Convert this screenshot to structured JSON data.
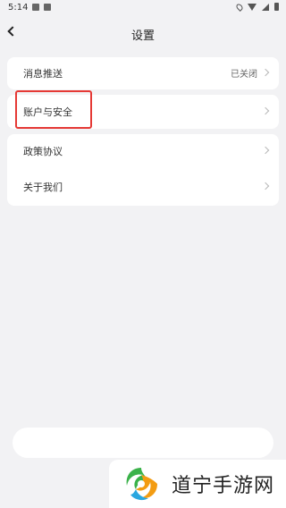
{
  "status_bar": {
    "time": "5:14"
  },
  "nav": {
    "title": "设置"
  },
  "settings": {
    "push": {
      "label": "消息推送",
      "value": "已关闭"
    },
    "account": {
      "label": "账户与安全"
    },
    "policy": {
      "label": "政策协议"
    },
    "about": {
      "label": "关于我们"
    }
  },
  "watermark": {
    "text": "道宁手游网"
  },
  "colors": {
    "background": "#f2f2f4",
    "card": "#ffffff",
    "highlight": "#e53935",
    "logo_green": "#3bb24a",
    "logo_orange": "#f39c12",
    "logo_blue": "#2aa7e0"
  }
}
